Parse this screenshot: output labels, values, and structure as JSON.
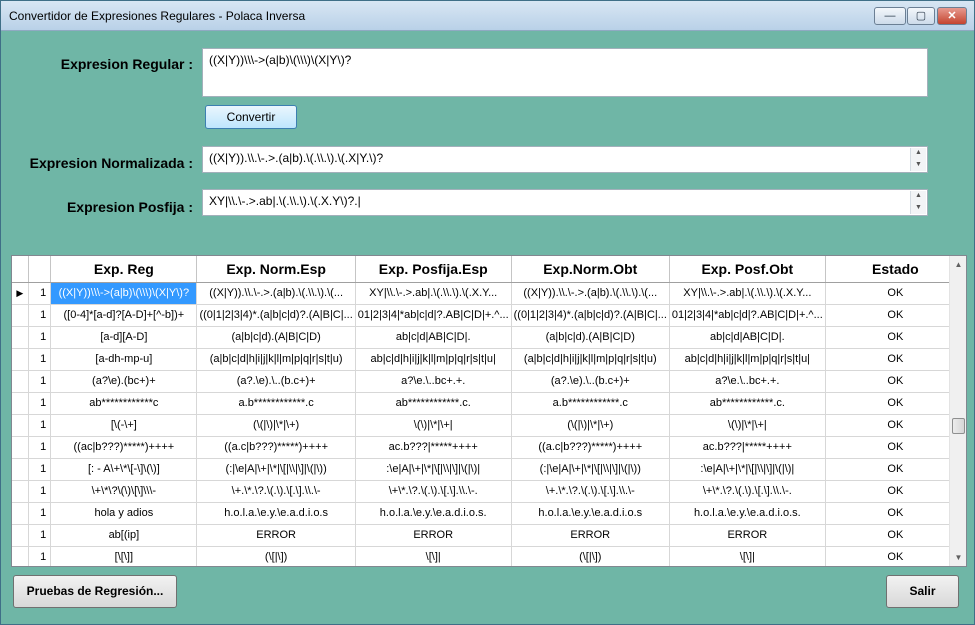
{
  "window": {
    "title": "Convertidor de Expresiones Regulares  - Polaca Inversa",
    "minimize_icon": "minimize-icon",
    "maximize_icon": "maximize-icon",
    "close_icon": "close-icon"
  },
  "form": {
    "regex_label": "Expresion Regular :",
    "regex_value": "((X|Y))\\\\\\->(a|b)\\(\\\\\\)\\(X|Y\\)?",
    "convert_label": "Convertir",
    "normalized_label": "Expresion Normalizada :",
    "normalized_value": "((X|Y)).\\\\.\\-.>.(a|b).\\(.\\\\.\\).\\(.X|Y.\\)?",
    "postfix_label": "Expresion Posfija :",
    "postfix_value": "XY|\\\\.\\-.>.ab|.\\(.\\\\.\\).\\(.X.Y\\)?.|"
  },
  "grid": {
    "columns": [
      "Exp. Reg",
      "Exp. Norm.Esp",
      "Exp. Posfija.Esp",
      "Exp.Norm.Obt",
      "Exp. Posf.Obt",
      "Estado"
    ],
    "rows": [
      {
        "num": "1",
        "cells": [
          "((X|Y))\\\\\\->(a|b)\\(\\\\\\)\\(X|Y\\)?",
          "((X|Y)).\\\\.\\-.>.(a|b).\\(.\\\\.\\).\\(...",
          "XY|\\\\.\\-.>.ab|.\\(.\\\\.\\).\\(.X.Y...",
          "((X|Y)).\\\\.\\-.>.(a|b).\\(.\\\\.\\).\\(...",
          "XY|\\\\.\\-.>.ab|.\\(.\\\\.\\).\\(.X.Y...",
          "OK"
        ]
      },
      {
        "num": "1",
        "cells": [
          "([0-4]*[a-d]?[A-D]+[^-b])+",
          "((0|1|2|3|4)*.(a|b|c|d)?.(A|B|C|...",
          "01|2|3|4|*ab|c|d|?.AB|C|D|+.^...",
          "((0|1|2|3|4)*.(a|b|c|d)?.(A|B|C|...",
          "01|2|3|4|*ab|c|d|?.AB|C|D|+.^...",
          "OK"
        ]
      },
      {
        "num": "1",
        "cells": [
          "[a-d][A-D]",
          "(a|b|c|d).(A|B|C|D)",
          "ab|c|d|AB|C|D|.",
          "(a|b|c|d).(A|B|C|D)",
          "ab|c|d|AB|C|D|.",
          "OK"
        ]
      },
      {
        "num": "1",
        "cells": [
          "[a-dh-mp-u]",
          "(a|b|c|d|h|i|j|k|l|m|p|q|r|s|t|u)",
          "ab|c|d|h|i|j|k|l|m|p|q|r|s|t|u|",
          "(a|b|c|d|h|i|j|k|l|m|p|q|r|s|t|u)",
          "ab|c|d|h|i|j|k|l|m|p|q|r|s|t|u|",
          "OK"
        ]
      },
      {
        "num": "1",
        "cells": [
          "(a?\\e).(bc+)+",
          "(a?.\\e).\\..(b.c+)+",
          "a?\\e.\\..bc+.+.",
          "(a?.\\e).\\..(b.c+)+",
          "a?\\e.\\..bc+.+.",
          "OK"
        ]
      },
      {
        "num": "1",
        "cells": [
          "ab************c",
          "a.b************.c",
          "ab************.c.",
          "a.b************.c",
          "ab************.c.",
          "OK"
        ]
      },
      {
        "num": "1",
        "cells": [
          "[\\(-\\+]",
          "(\\(|\\)|\\*|\\+)",
          "\\(\\)|\\*|\\+|",
          "(\\(|\\)|\\*|\\+)",
          "\\(\\)|\\*|\\+|",
          "OK"
        ]
      },
      {
        "num": "1",
        "cells": [
          "((ac|b???)*****)++++",
          "((a.c|b???)*****)++++",
          "ac.b???|*****++++",
          "((a.c|b???)*****)++++",
          "ac.b???|*****++++",
          "OK"
        ]
      },
      {
        "num": "1",
        "cells": [
          "[: - A\\+\\*\\[-\\]\\(\\)]",
          "(:|\\e|A|\\+|\\*|\\[|\\\\|\\]|\\(|\\))",
          ":\\e|A|\\+|\\*|\\[|\\\\|\\]|\\(|\\)|",
          "(:|\\e|A|\\+|\\*|\\[|\\\\|\\]|\\(|\\))",
          ":\\e|A|\\+|\\*|\\[|\\\\|\\]|\\(|\\)|",
          "OK"
        ]
      },
      {
        "num": "1",
        "cells": [
          "\\+\\*\\?\\(\\)\\[\\]\\\\\\-",
          "\\+.\\*.\\?.\\(.\\).\\[.\\].\\\\.\\-",
          "\\+\\*.\\?.\\(.\\).\\[.\\].\\\\.\\-.",
          "\\+.\\*.\\?.\\(.\\).\\[.\\].\\\\.\\-",
          "\\+\\*.\\?.\\(.\\).\\[.\\].\\\\.\\-.",
          "OK"
        ]
      },
      {
        "num": "1",
        "cells": [
          "hola y adios",
          "h.o.l.a.\\e.y.\\e.a.d.i.o.s",
          "h.o.l.a.\\e.y.\\e.a.d.i.o.s.",
          "h.o.l.a.\\e.y.\\e.a.d.i.o.s",
          "h.o.l.a.\\e.y.\\e.a.d.i.o.s.",
          "OK"
        ]
      },
      {
        "num": "1",
        "cells": [
          "ab[(ip]",
          "ERROR",
          "ERROR",
          "ERROR",
          "ERROR",
          "OK"
        ]
      },
      {
        "num": "1",
        "cells": [
          "[\\[\\]]",
          "(\\[|\\])",
          "\\[\\]|",
          "(\\[|\\])",
          "\\[\\]|",
          "OK"
        ]
      }
    ]
  },
  "footer": {
    "regression_label": "Pruebas de Regresión...",
    "exit_label": "Salir"
  }
}
